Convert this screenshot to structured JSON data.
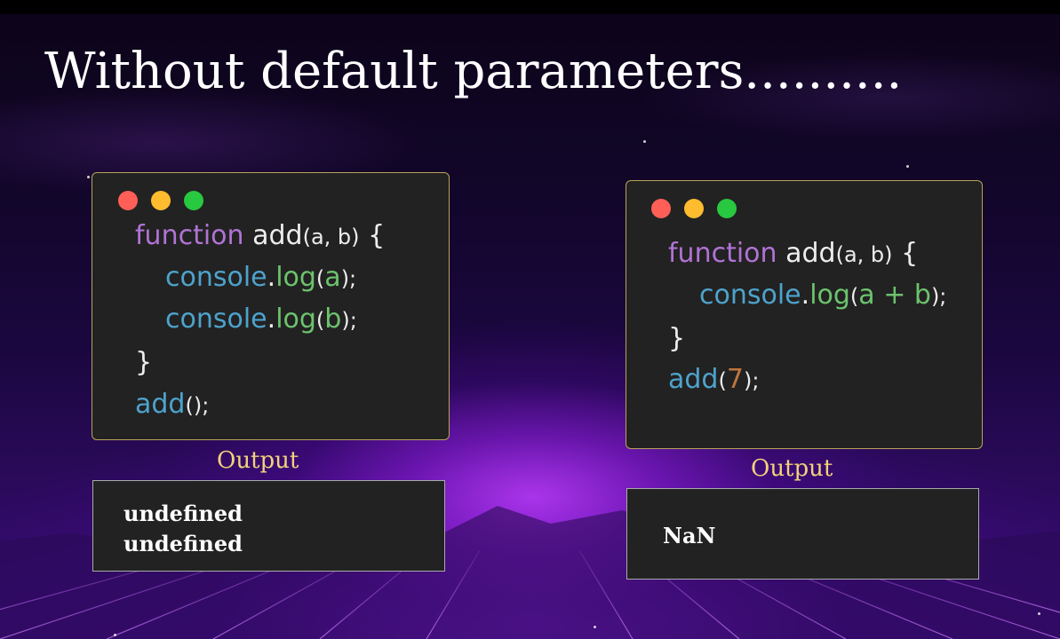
{
  "title": "Without default parameters..........",
  "colors": {
    "dot_red": "#ff5f57",
    "dot_yellow": "#febc2e",
    "dot_green": "#28c840",
    "keyword": "#b073d4",
    "identifier": "#4da3cc",
    "method": "#6cc36d",
    "number": "#c0753c",
    "output_label": "#f3d27a"
  },
  "left": {
    "code": {
      "l1_kw": "function",
      "l1_name": "add",
      "l1_params": "(a, b)",
      "l1_brace": "{",
      "l2_obj": "console",
      "l2_dot": ".",
      "l2_method": "log",
      "l2_open": "(",
      "l2_arg": "a",
      "l2_close": ");",
      "l3_obj": "console",
      "l3_dot": ".",
      "l3_method": "log",
      "l3_open": "(",
      "l3_arg": "b",
      "l3_close": ");",
      "l4_brace": "}",
      "l5_call": "add",
      "l5_args": "();"
    },
    "output_label": "Output",
    "output_lines": [
      "undefined",
      "undefined"
    ]
  },
  "right": {
    "code": {
      "l1_kw": "function",
      "l1_name": "add",
      "l1_params": "(a, b)",
      "l1_brace": "{",
      "l2_obj": "console",
      "l2_dot": ".",
      "l2_method": "log",
      "l2_open": "(",
      "l2_arg": "a + b",
      "l2_close": ");",
      "l3_brace": "}",
      "l4_call": "add",
      "l4_open": "(",
      "l4_num": "7",
      "l4_close": ");"
    },
    "output_label": "Output",
    "output_lines": [
      "NaN"
    ]
  }
}
